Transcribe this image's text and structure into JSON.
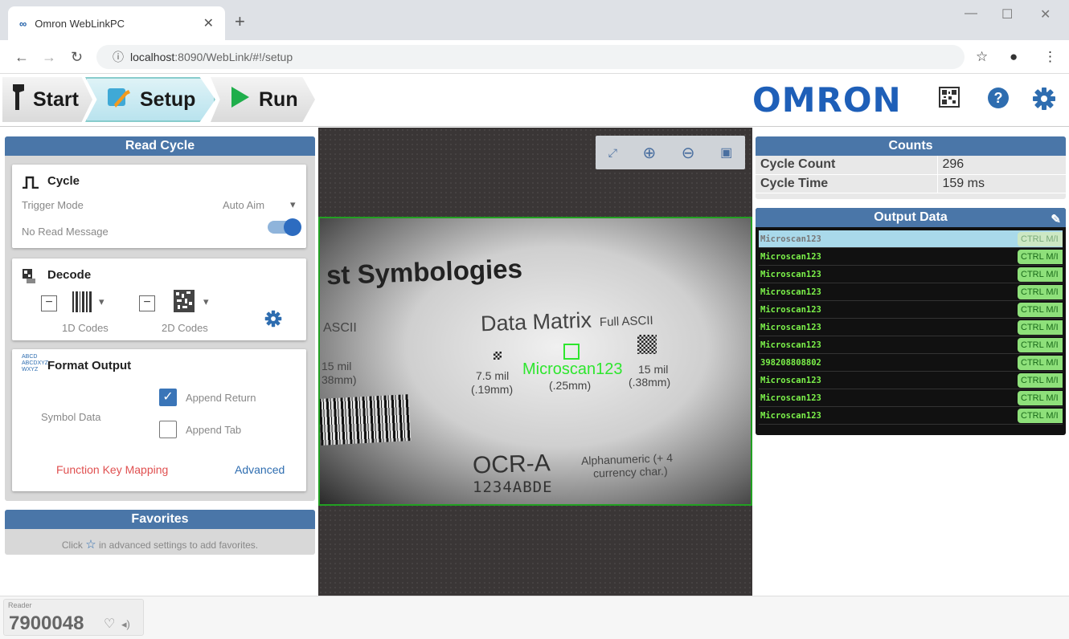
{
  "browser": {
    "tab_title": "Omron WebLinkPC",
    "url_host": "localhost",
    "url_rest": ":8090/WebLink/#!/setup"
  },
  "header": {
    "steps": [
      "Start",
      "Setup",
      "Run"
    ],
    "logo": "OMRON"
  },
  "read_cycle": {
    "title": "Read Cycle",
    "cycle": {
      "heading": "Cycle",
      "trigger_mode_label": "Trigger Mode",
      "trigger_mode_value": "Auto Aim",
      "no_read_label": "No Read Message",
      "no_read_enabled": true
    },
    "decode": {
      "heading": "Decode",
      "codes_1d": "1D Codes",
      "codes_2d": "2D Codes"
    },
    "format_output": {
      "heading": "Format Output",
      "symbol_data_label": "Symbol Data",
      "append_return": "Append Return",
      "append_return_checked": true,
      "append_tab": "Append Tab",
      "append_tab_checked": false,
      "function_key_mapping": "Function Key Mapping",
      "advanced": "Advanced"
    }
  },
  "favorites": {
    "title": "Favorites",
    "hint_before": "Click",
    "hint_after": "in advanced settings to add favorites."
  },
  "image": {
    "heading_text": "st Symbologies",
    "data_matrix": "Data Matrix",
    "full_ascii": "Full ASCII",
    "ascii_left": "ASCII",
    "size1": "7.5 mil",
    "size1_mm": "(.19mm)",
    "size2_mm": "(.25mm)",
    "size3": "15 mil",
    "size3_mm": "(.38mm)",
    "left_size": "15 mil",
    "left_size_mm": "38mm)",
    "ocr": "OCR-A",
    "ocr_desc": "Alphanumeric (+ 4",
    "ocr_desc2": "currency char.)",
    "ocr_number": "1234ABDE",
    "decoded_label": "Microscan123"
  },
  "counts": {
    "title": "Counts",
    "rows": [
      {
        "key": "Cycle Count",
        "value": "296"
      },
      {
        "key": "Cycle Time",
        "value": "159 ms"
      }
    ]
  },
  "output_data": {
    "title": "Output Data",
    "ctrl_label": "CTRL M/I",
    "rows": [
      "Microscan123",
      "Microscan123",
      "Microscan123",
      "Microscan123",
      "Microscan123",
      "Microscan123",
      "Microscan123",
      "398208808802",
      "Microscan123",
      "Microscan123",
      "Microscan123"
    ]
  },
  "footer": {
    "reader_label": "Reader",
    "reader_number": "7900048"
  },
  "colors": {
    "accent": "#4a76a8",
    "brand": "#1e5fb8",
    "decode_green": "#2ee62e",
    "link_red": "#e05050"
  }
}
